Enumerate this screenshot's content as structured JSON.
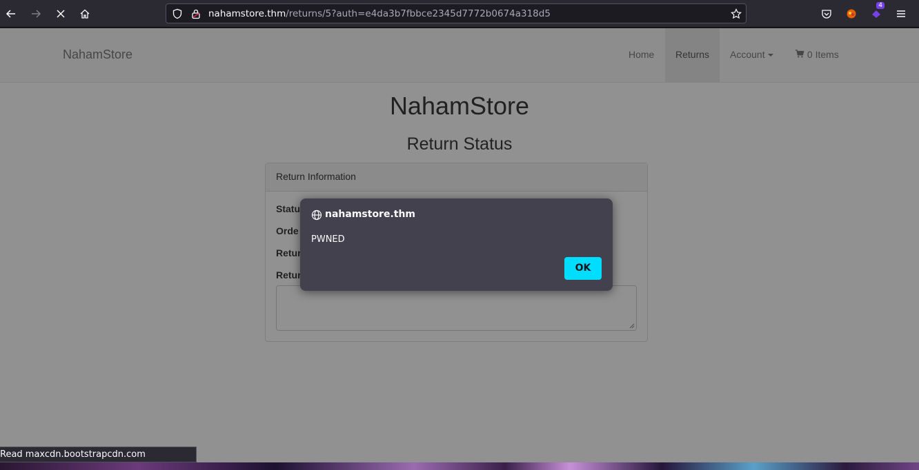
{
  "browser": {
    "url_host": "nahamstore.thm",
    "url_path": "/returns/5?auth=e4da3b7fbbce2345d7772b0674a318d5",
    "extension_badge": "4",
    "status_text": "Read maxcdn.bootstrapcdn.com",
    "accent_color": "#00ddff"
  },
  "navbar": {
    "brand": "NahamStore",
    "items": [
      {
        "label": "Home"
      },
      {
        "label": "Returns"
      },
      {
        "label": "Account"
      },
      {
        "label": "0 Items"
      }
    ]
  },
  "page": {
    "title": "NahamStore",
    "subtitle": "Return Status",
    "panel_heading": "Return Information",
    "labels": [
      "Statu",
      "Orde",
      "Retur",
      "Retur"
    ]
  },
  "dialog": {
    "origin": "nahamstore.thm",
    "message": "PWNED",
    "ok_label": "OK"
  },
  "icons": [
    "back-icon",
    "forward-icon",
    "stop-icon",
    "home-icon",
    "shield-icon",
    "lock-icon",
    "star-icon",
    "pocket-icon",
    "extension-icon",
    "menu-icon",
    "globe-icon",
    "cart-icon"
  ]
}
